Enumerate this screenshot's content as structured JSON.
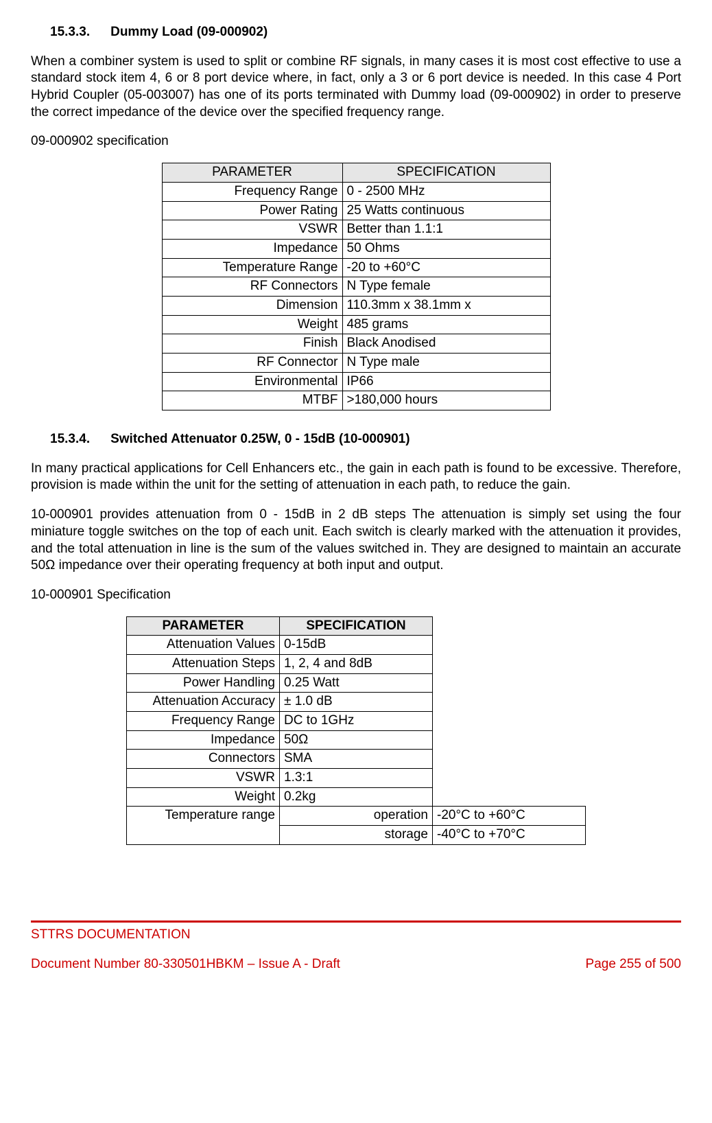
{
  "section1": {
    "number": "15.3.3.",
    "title": "Dummy Load (09-000902)",
    "para1": "When a combiner system is used to split or combine RF signals, in many cases it is most cost effective to use a standard stock item 4, 6 or 8 port device where, in fact, only a 3 or 6 port device is needed. In this case 4 Port Hybrid Coupler (05-003007) has one of its ports terminated with Dummy load (09-000902) in order to preserve the correct impedance of the device over the specified frequency range.",
    "specLabel": "09-000902 specification",
    "table": {
      "headParam": "PARAMETER",
      "headSpec": "SPECIFICATION",
      "rows": [
        {
          "p": "Frequency Range",
          "s": "0 - 2500 MHz"
        },
        {
          "p": "Power Rating",
          "s": "25 Watts continuous"
        },
        {
          "p": "VSWR",
          "s": "Better than 1.1:1"
        },
        {
          "p": "Impedance",
          "s": "50 Ohms"
        },
        {
          "p": "Temperature Range",
          "s": "-20 to +60°C"
        },
        {
          "p": "RF Connectors",
          "s": "N Type female"
        },
        {
          "p": "Dimension",
          "s": "110.3mm x 38.1mm x"
        },
        {
          "p": "Weight",
          "s": "485 grams"
        },
        {
          "p": "Finish",
          "s": "Black Anodised"
        },
        {
          "p": "RF Connector",
          "s": "N Type male"
        },
        {
          "p": "Environmental",
          "s": "IP66"
        },
        {
          "p": "MTBF",
          "s": ">180,000 hours"
        }
      ]
    }
  },
  "section2": {
    "number": "15.3.4.",
    "title": "Switched Attenuator 0.25W, 0 - 15dB (10-000901)",
    "para1": "In many practical applications for Cell Enhancers etc., the gain in each path is found to be excessive. Therefore, provision is made within the unit for the setting of attenuation in each path, to reduce the gain.",
    "para2": "10-000901 provides attenuation from 0 - 15dB in 2 dB steps The attenuation is simply set using the four miniature toggle switches on the top of each unit. Each switch is clearly marked with the attenuation it provides, and the total attenuation in line is the sum of the values switched in. They are designed to maintain an accurate 50Ω impedance over their operating frequency at both input and output.",
    "specLabel": "10-000901 Specification",
    "table": {
      "headParam": "PARAMETER",
      "headSpec": "SPECIFICATION",
      "rows": [
        {
          "p": "Attenuation Values",
          "s": "0-15dB"
        },
        {
          "p": "Attenuation Steps",
          "s": "1, 2, 4 and 8dB"
        },
        {
          "p": "Power Handling",
          "s": "0.25 Watt"
        },
        {
          "p": "Attenuation Accuracy",
          "s": "± 1.0 dB"
        },
        {
          "p": "Frequency Range",
          "s": "DC to 1GHz"
        },
        {
          "p": "Impedance",
          "s": "50Ω"
        },
        {
          "p": "Connectors",
          "s": "SMA"
        },
        {
          "p": "VSWR",
          "s": "1.3:1"
        },
        {
          "p": "Weight",
          "s": "0.2kg"
        }
      ],
      "tempLabel": "Temperature range",
      "opLabel": "operation",
      "opVal": "-20°C to +60°C",
      "stLabel": "storage",
      "stVal": "-40°C to +70°C"
    }
  },
  "footer": {
    "doc": "STTRS DOCUMENTATION",
    "left": "Document Number 80-330501HBKM – Issue A - Draft",
    "right": "Page 255 of 500"
  }
}
